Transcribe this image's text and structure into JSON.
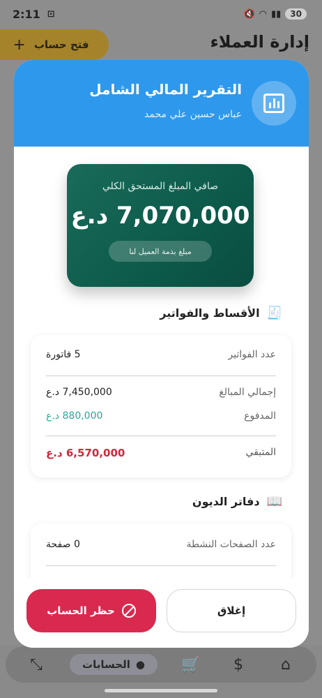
{
  "status_bar": {
    "time": "2:11",
    "battery": "30"
  },
  "background": {
    "page_title": "إدارة العملاء",
    "open_account_label": "فتح حساب",
    "bottom_nav": {
      "accounts_label": "الحسابات"
    }
  },
  "modal": {
    "title": "التقرير المالي الشامل",
    "subtitle": "عباس حسين علي محمد",
    "net_card": {
      "label": "صافي المبلغ المستحق الكلي",
      "amount": "7,070,000 د.ع",
      "note": "مبلغ بذمة العميل لنا"
    },
    "installments": {
      "title": "الأقساط والفواتير",
      "invoices_count_label": "عدد الفواتير",
      "invoices_count_value": "5 فاتورة",
      "total_label": "إجمالي المبالغ",
      "total_value": "7,450,000 د.ع",
      "paid_label": "المدفوع",
      "paid_value": "880,000 د.ع",
      "remaining_label": "المتبقي",
      "remaining_value": "6,570,000 د.ع"
    },
    "debts": {
      "title": "دفاتر الديون",
      "active_pages_label": "عدد الصفحات النشطة",
      "active_pages_value": "0 صفحة"
    },
    "buttons": {
      "close": "إغلاق",
      "ban": "حظر الحساب"
    }
  },
  "colors": {
    "header": "#2e98ec",
    "net_card": "#0d5a4a",
    "paid": "#2ba59a",
    "remaining": "#d2283a",
    "ban_button": "#d9294e"
  }
}
